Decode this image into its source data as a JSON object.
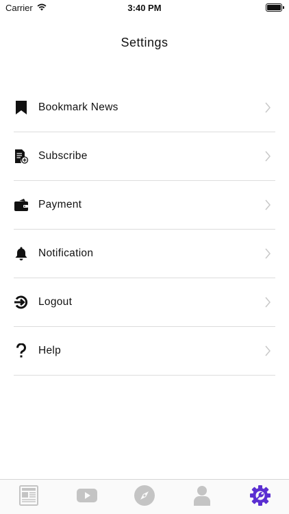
{
  "status_bar": {
    "carrier": "Carrier",
    "time": "3:40 PM",
    "wifi_icon": "wifi-icon",
    "battery_icon": "battery-icon"
  },
  "header": {
    "title": "Settings"
  },
  "settings": {
    "items": [
      {
        "label": "Bookmark News",
        "icon": "bookmark-icon"
      },
      {
        "label": "Subscribe",
        "icon": "subscribe-document-icon"
      },
      {
        "label": "Payment",
        "icon": "wallet-icon"
      },
      {
        "label": "Notification",
        "icon": "bell-icon"
      },
      {
        "label": "Logout",
        "icon": "logout-icon"
      },
      {
        "label": "Help",
        "icon": "question-mark-icon"
      }
    ],
    "chevron_icon": "chevron-right-icon"
  },
  "tab_bar": {
    "tabs": [
      {
        "icon": "newspaper-icon",
        "selected": false
      },
      {
        "icon": "video-play-icon",
        "selected": false
      },
      {
        "icon": "compass-icon",
        "selected": false
      },
      {
        "icon": "profile-icon",
        "selected": false
      },
      {
        "icon": "settings-gear-icon",
        "selected": true
      }
    ],
    "active_color": "#5b2fd1",
    "inactive_color": "#c4c4c4"
  }
}
